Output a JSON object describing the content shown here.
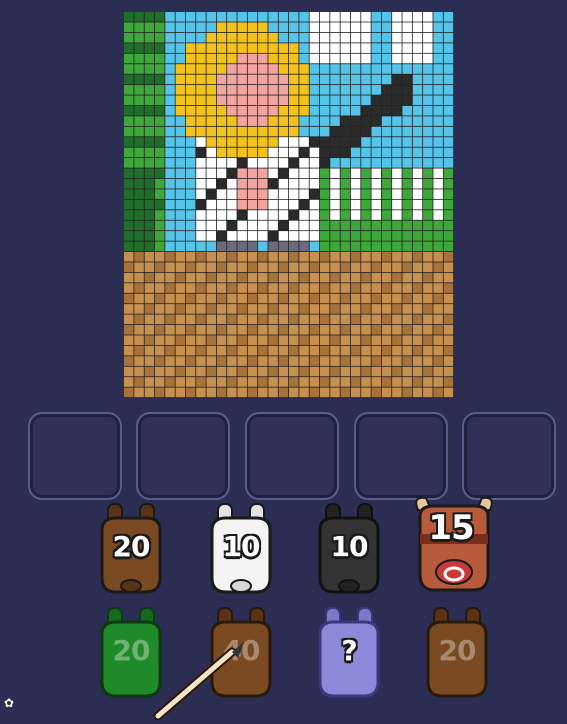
{
  "puzzle": {
    "grid_cols": 32,
    "grid_rows": 37,
    "palette": {
      "sky": "#56c3e8",
      "cloud": "#ffffff",
      "grass": "#3ea83a",
      "dark_grass": "#1f6e2a",
      "hair": "#f3c21c",
      "skin": "#f2a4a0",
      "shirt": "#ffffff",
      "black": "#2a2a2a",
      "pants": "#6b6b7e",
      "ground": "#c8904f",
      "ground_dark": "#a8733b"
    }
  },
  "slots": [
    {
      "state": "empty"
    },
    {
      "state": "empty"
    },
    {
      "state": "empty"
    },
    {
      "state": "empty"
    },
    {
      "state": "empty"
    }
  ],
  "jars_row1": [
    {
      "count": "20",
      "color": "#7a4a22",
      "kind": "brown"
    },
    {
      "count": "10",
      "color": "#f2f2f2",
      "kind": "white"
    },
    {
      "count": "10",
      "color": "#333333",
      "kind": "black"
    },
    {
      "count": "15",
      "color": "#b85a3c",
      "kind": "bull"
    }
  ],
  "jars_row2": [
    {
      "count": "20",
      "color": "#1f8a2a",
      "kind": "green"
    },
    {
      "count": "40",
      "color": "#7a4a22",
      "kind": "brown"
    },
    {
      "count": "?",
      "color": "#8c8ad8",
      "kind": "mystery"
    },
    {
      "count": "20",
      "color": "#7a4a22",
      "kind": "brown"
    }
  ],
  "icons": {
    "pencil": "pencil-icon",
    "corner": "flower-icon"
  },
  "corner_glyph": "✿"
}
